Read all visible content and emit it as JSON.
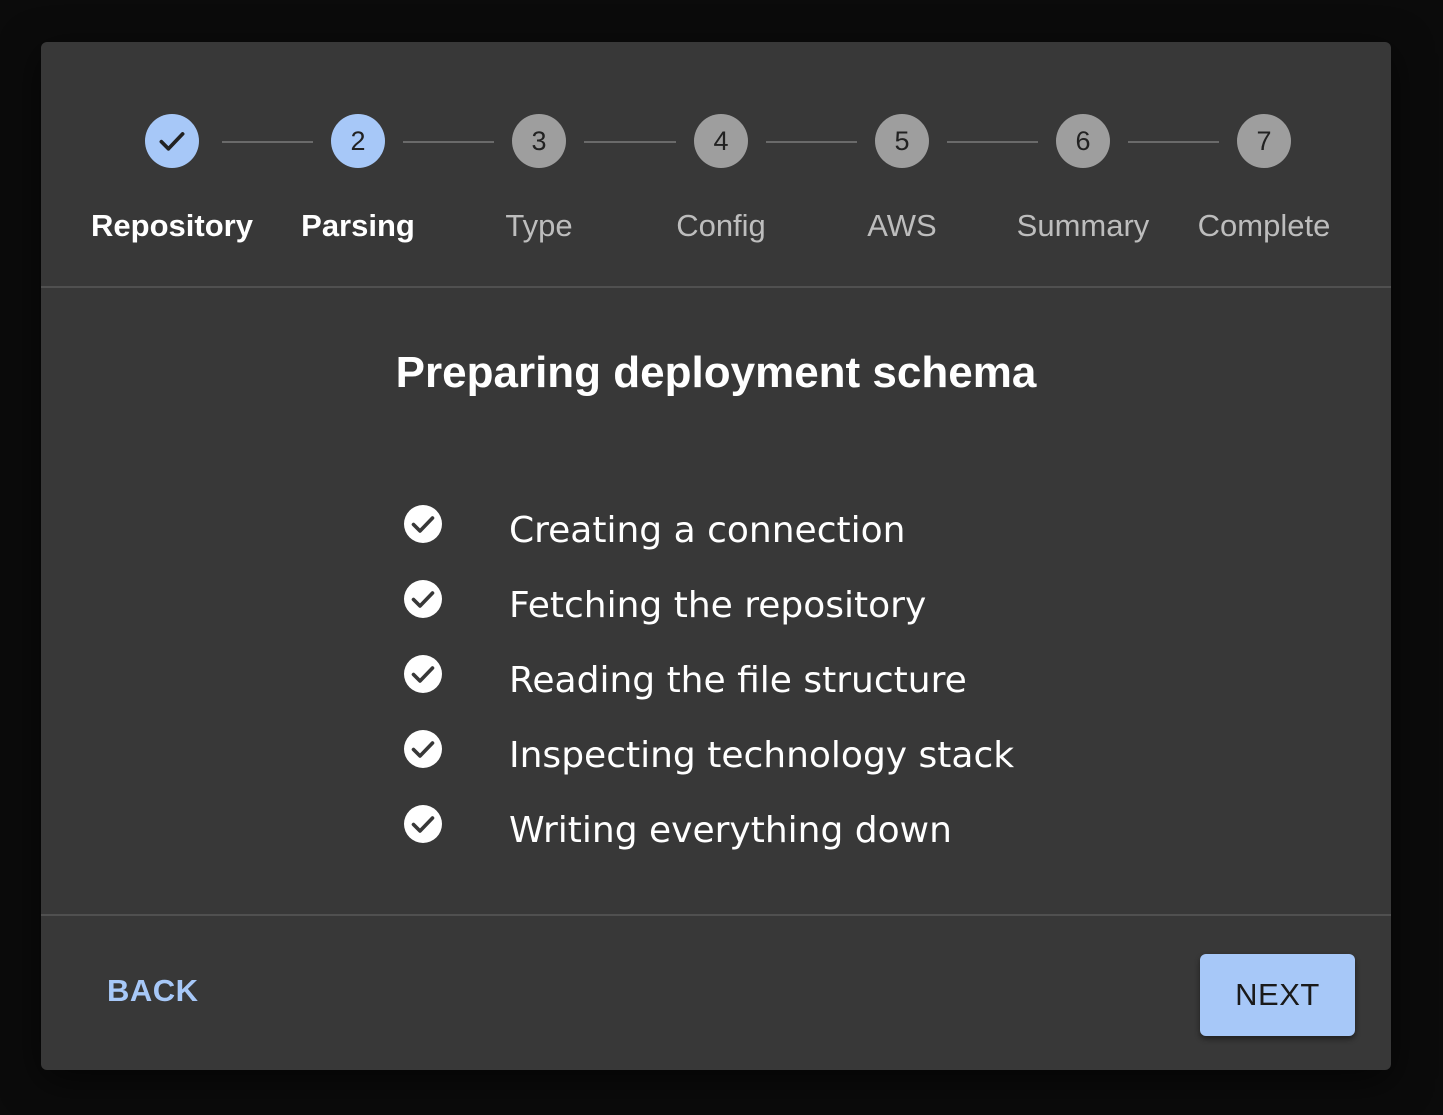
{
  "stepper": {
    "steps": [
      {
        "number": "",
        "label": "Repository",
        "state": "done"
      },
      {
        "number": "2",
        "label": "Parsing",
        "state": "active"
      },
      {
        "number": "3",
        "label": "Type",
        "state": "pending"
      },
      {
        "number": "4",
        "label": "Config",
        "state": "pending"
      },
      {
        "number": "5",
        "label": "AWS",
        "state": "pending"
      },
      {
        "number": "6",
        "label": "Summary",
        "state": "pending"
      },
      {
        "number": "7",
        "label": "Complete",
        "state": "pending"
      }
    ]
  },
  "main": {
    "title": "Preparing deployment schema",
    "tasks": [
      {
        "label": "Creating a connection",
        "status": "complete"
      },
      {
        "label": "Fetching the repository",
        "status": "complete"
      },
      {
        "label": "Reading the file structure",
        "status": "complete"
      },
      {
        "label": "Inspecting technology stack",
        "status": "complete"
      },
      {
        "label": "Writing everything down",
        "status": "complete"
      }
    ]
  },
  "footer": {
    "back_label": "BACK",
    "next_label": "NEXT"
  },
  "colors": {
    "accent": "#a7c8f8",
    "surface": "#383838",
    "backdrop": "#0b0b0b",
    "pending_step": "#9e9e9e"
  }
}
